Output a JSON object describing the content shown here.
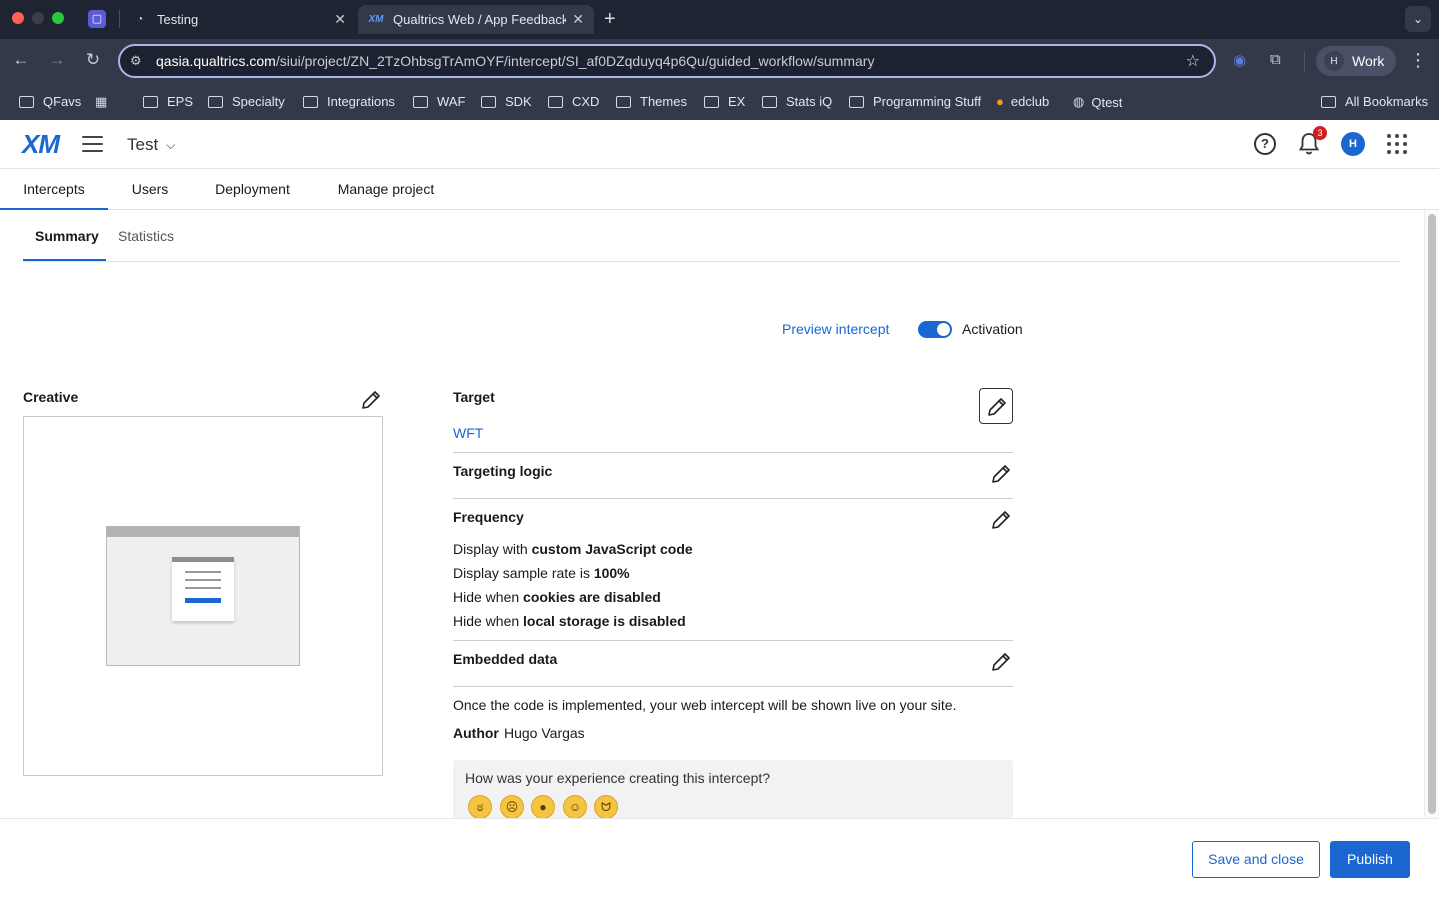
{
  "browser": {
    "tabs": [
      {
        "title": "Testing",
        "icon": "globe-icon"
      },
      {
        "title": "Qualtrics Web / App Feedback",
        "icon": "xm-favicon",
        "favicon_text": "XM"
      }
    ],
    "url_host": "qasia.qualtrics.com",
    "url_path": "/siui/project/ZN_2TzOhbsgTrAmOYF/intercept/SI_af0DZqduyq4p6Qu/guided_workflow/summary",
    "profile_initial": "H",
    "profile_label": "Work",
    "bookmarks": [
      "QFavs",
      "EPS",
      "Specialty",
      "Integrations",
      "WAF",
      "SDK",
      "CXD",
      "Themes",
      "EX",
      "Stats iQ",
      "Programming Stuff",
      "edclub",
      "Qtest"
    ],
    "all_bookmarks": "All Bookmarks"
  },
  "app": {
    "logo": "XM",
    "project_name": "Test",
    "notification_count": "3",
    "user_initial": "H",
    "accent_color": "#1a67d2"
  },
  "nav": {
    "tabs": [
      "Intercepts",
      "Users",
      "Deployment",
      "Manage project"
    ],
    "active_tab": "Intercepts"
  },
  "subnav": {
    "tabs": [
      "Summary",
      "Statistics"
    ],
    "active_tab": "Summary"
  },
  "actions": {
    "preview": "Preview intercept",
    "activation": "Activation",
    "activation_on": true
  },
  "creative": {
    "title": "Creative"
  },
  "target": {
    "title": "Target",
    "value": "WFT"
  },
  "targeting_logic": {
    "title": "Targeting logic"
  },
  "frequency": {
    "title": "Frequency",
    "lines": [
      {
        "pre": "Display with ",
        "bold": "custom JavaScript code"
      },
      {
        "pre": "Display sample rate is ",
        "bold": "100%"
      },
      {
        "pre": "Hide when ",
        "bold": "cookies are disabled"
      },
      {
        "pre": "Hide when ",
        "bold": "local storage is disabled"
      }
    ]
  },
  "embedded_data": {
    "title": "Embedded data"
  },
  "implementation_note": "Once the code is implemented, your web intercept will be shown live on your site.",
  "author": {
    "label": "Author",
    "name": "Hugo Vargas"
  },
  "feedback": {
    "question": "How was your experience creating this intercept?",
    "options": [
      "very-dissatisfied-emoji",
      "dissatisfied-emoji",
      "neutral-emoji",
      "satisfied-emoji",
      "very-satisfied-emoji"
    ]
  },
  "footer": {
    "save_close": "Save and close",
    "publish": "Publish"
  }
}
